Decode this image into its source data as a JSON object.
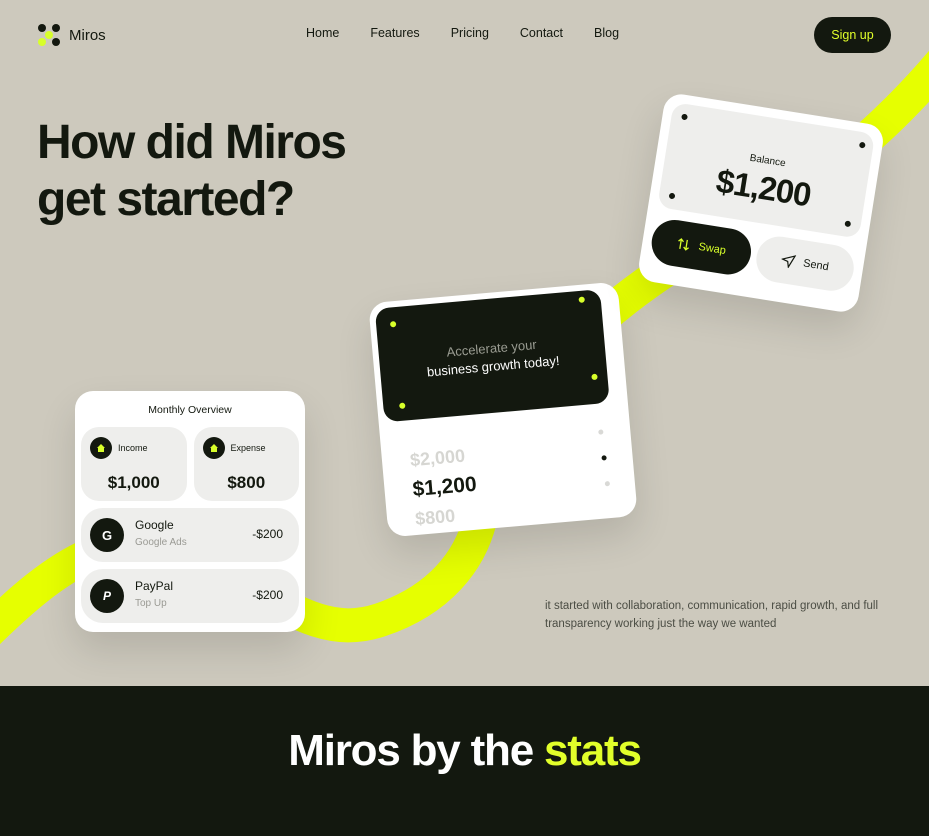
{
  "brand": {
    "name": "Miros"
  },
  "nav": {
    "links": [
      "Home",
      "Features",
      "Pricing",
      "Contact",
      "Blog"
    ],
    "signup_label": "Sign up"
  },
  "hero": {
    "headline_line1": "How did Miros",
    "headline_line2": "get started?",
    "description": "it started with collaboration, communication, rapid growth, and full transparency working just the way we wanted"
  },
  "overview_card": {
    "title": "Monthly Overview",
    "income": {
      "label": "Income",
      "amount": "$1,000",
      "icon": "home-icon"
    },
    "expense": {
      "label": "Expense",
      "amount": "$800",
      "icon": "home-icon"
    },
    "transactions": [
      {
        "name": "Google",
        "sub": "Google Ads",
        "amount": "-$200",
        "icon": "google-icon"
      },
      {
        "name": "PayPal",
        "sub": "Top Up",
        "amount": "-$200",
        "icon": "paypal-icon"
      }
    ]
  },
  "growth_card": {
    "line1": "Accelerate your",
    "line2": "business growth today!",
    "values": [
      "$2,000",
      "$1,200",
      "$800"
    ]
  },
  "balance_card": {
    "label": "Balance",
    "amount": "$1,200",
    "swap_label": "Swap",
    "send_label": "Send"
  },
  "stats": {
    "title_prefix": "Miros by the ",
    "title_highlight": "stats"
  },
  "colors": {
    "background": "#cdc9bd",
    "dark": "#13180f",
    "accent": "#e2ff2a",
    "ribbon": "#e6ff00"
  }
}
